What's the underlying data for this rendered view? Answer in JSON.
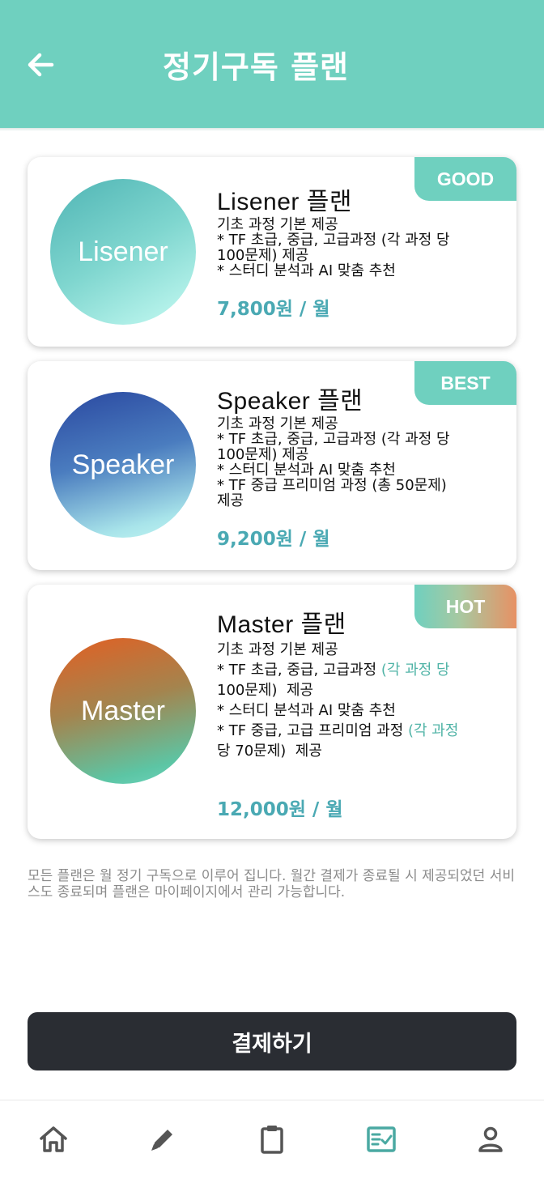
{
  "header": {
    "title": "정기구독 플랜",
    "back_icon": "arrow-left-icon"
  },
  "plans": [
    {
      "badge": "GOOD",
      "circle_label": "Lisener",
      "title": "Lisener 플랜",
      "features": [
        "기초 과정 기본 제공",
        "* TF 초급, 중급, 고급과정 (각 과정 당",
        "100문제) 제공",
        "* 스터디 분석과 AI 맞춤 추천"
      ],
      "price": "7,800원 / 월"
    },
    {
      "badge": "BEST",
      "circle_label": "Speaker",
      "title": "Speaker 플랜",
      "features": [
        "기초 과정 기본 제공",
        "* TF 초급, 중급, 고급과정 (각 과정 당",
        "100문제) 제공",
        "* 스터디 분석과 AI 맞춤 추천",
        "* TF 중급 프리미엄 과정 (총 50문제)",
        "제공"
      ],
      "price": "9,200원 / 월"
    },
    {
      "badge": "HOT",
      "circle_label": "Master",
      "title": "Master 플랜",
      "features": [
        "기초 과정 기본 제공",
        "* TF 초급, 중급, 고급과정 (각 과정 당",
        "100문제)  제공",
        "* 스터디 분석과 AI 맞춤 추천",
        "* TF 중급, 고급 프리미엄 과정 (각 과정",
        "당 70문제)  제공"
      ],
      "price": "12,000원 / 월"
    }
  ],
  "notice": "모든 플랜은 월 정기 구독으로 이루어 집니다. 월간 결제가 종료될 시 제공되었던 서비스도 종료되며 플랜은 마이페이지에서 관리 가능합니다.",
  "pay_button": "결제하기",
  "tabbar": {
    "items": [
      "home-icon",
      "pencil-icon",
      "clipboard-icon",
      "checklist-icon",
      "person-icon"
    ],
    "active": "checklist-icon"
  },
  "colors": {
    "accent": "#6fd0bf",
    "price": "#4aa9b3",
    "button": "#2a2d33",
    "tab_inactive": "#555555",
    "tab_active": "#4aa9a2"
  }
}
